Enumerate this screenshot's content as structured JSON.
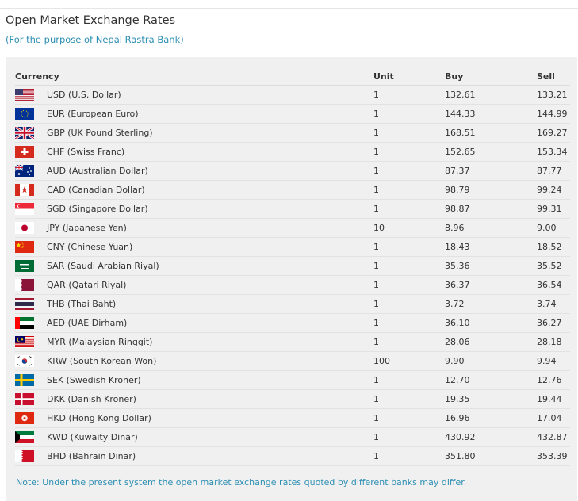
{
  "page": {
    "title": "Open Market Exchange Rates",
    "subtitle": "(For the purpose of Nepal Rastra Bank)",
    "note": "Note: Under the present system the open market exchange rates quoted by different banks may differ."
  },
  "table": {
    "headers": {
      "currency": "Currency",
      "unit": "Unit",
      "buy": "Buy",
      "sell": "Sell"
    },
    "rows": [
      {
        "flag": "us-flag-icon",
        "currency": "USD (U.S. Dollar)",
        "unit": "1",
        "buy": "132.61",
        "sell": "133.21"
      },
      {
        "flag": "eu-flag-icon",
        "currency": "EUR (European Euro)",
        "unit": "1",
        "buy": "144.33",
        "sell": "144.99"
      },
      {
        "flag": "gb-flag-icon",
        "currency": "GBP (UK Pound Sterling)",
        "unit": "1",
        "buy": "168.51",
        "sell": "169.27"
      },
      {
        "flag": "ch-flag-icon",
        "currency": "CHF (Swiss Franc)",
        "unit": "1",
        "buy": "152.65",
        "sell": "153.34"
      },
      {
        "flag": "au-flag-icon",
        "currency": "AUD (Australian Dollar)",
        "unit": "1",
        "buy": "87.37",
        "sell": "87.77"
      },
      {
        "flag": "ca-flag-icon",
        "currency": "CAD (Canadian Dollar)",
        "unit": "1",
        "buy": "98.79",
        "sell": "99.24"
      },
      {
        "flag": "sg-flag-icon",
        "currency": "SGD (Singapore Dollar)",
        "unit": "1",
        "buy": "98.87",
        "sell": "99.31"
      },
      {
        "flag": "jp-flag-icon",
        "currency": "JPY (Japanese Yen)",
        "unit": "10",
        "buy": "8.96",
        "sell": "9.00"
      },
      {
        "flag": "cn-flag-icon",
        "currency": "CNY (Chinese Yuan)",
        "unit": "1",
        "buy": "18.43",
        "sell": "18.52"
      },
      {
        "flag": "sa-flag-icon",
        "currency": "SAR (Saudi Arabian Riyal)",
        "unit": "1",
        "buy": "35.36",
        "sell": "35.52"
      },
      {
        "flag": "qa-flag-icon",
        "currency": "QAR (Qatari Riyal)",
        "unit": "1",
        "buy": "36.37",
        "sell": "36.54"
      },
      {
        "flag": "th-flag-icon",
        "currency": "THB (Thai Baht)",
        "unit": "1",
        "buy": "3.72",
        "sell": "3.74"
      },
      {
        "flag": "ae-flag-icon",
        "currency": "AED (UAE Dirham)",
        "unit": "1",
        "buy": "36.10",
        "sell": "36.27"
      },
      {
        "flag": "my-flag-icon",
        "currency": "MYR (Malaysian Ringgit)",
        "unit": "1",
        "buy": "28.06",
        "sell": "28.18"
      },
      {
        "flag": "kr-flag-icon",
        "currency": "KRW (South Korean Won)",
        "unit": "100",
        "buy": "9.90",
        "sell": "9.94"
      },
      {
        "flag": "se-flag-icon",
        "currency": "SEK (Swedish Kroner)",
        "unit": "1",
        "buy": "12.70",
        "sell": "12.76"
      },
      {
        "flag": "dk-flag-icon",
        "currency": "DKK (Danish Kroner)",
        "unit": "1",
        "buy": "19.35",
        "sell": "19.44"
      },
      {
        "flag": "hk-flag-icon",
        "currency": "HKD (Hong Kong Dollar)",
        "unit": "1",
        "buy": "16.96",
        "sell": "17.04"
      },
      {
        "flag": "kw-flag-icon",
        "currency": "KWD (Kuwaity Dinar)",
        "unit": "1",
        "buy": "430.92",
        "sell": "432.87"
      },
      {
        "flag": "bh-flag-icon",
        "currency": "BHD (Bahrain Dinar)",
        "unit": "1",
        "buy": "351.80",
        "sell": "353.39"
      }
    ]
  },
  "colors": {
    "title_text": "#333333",
    "accent_text": "#2d8fb3",
    "panel_bg": "#f0f0f0",
    "row_divider": "#e2e2e2"
  }
}
